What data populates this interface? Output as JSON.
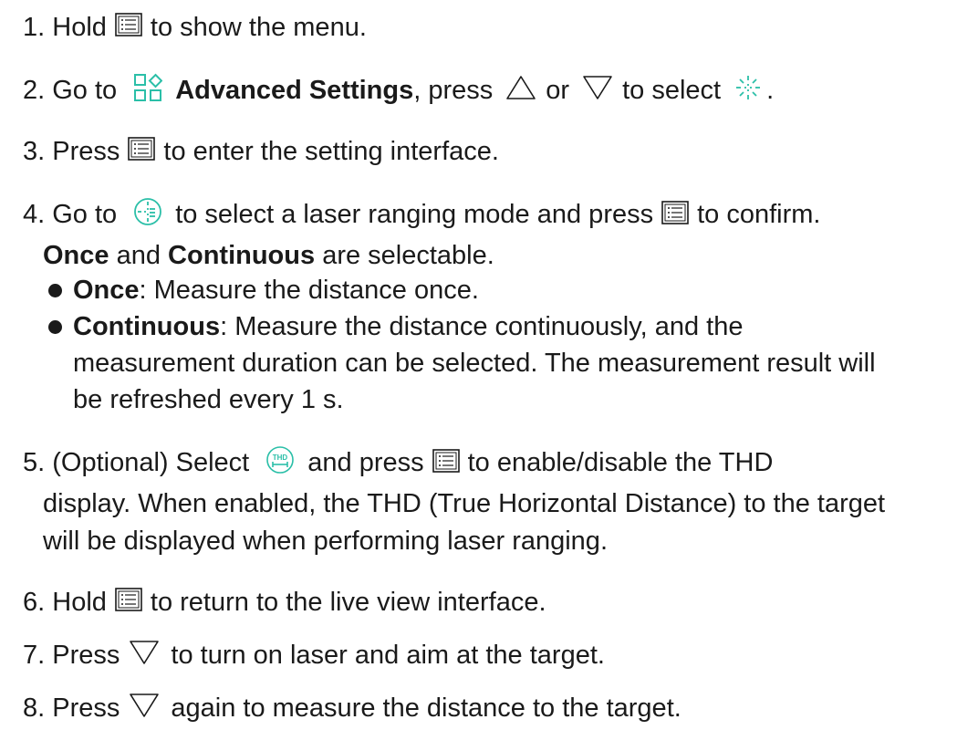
{
  "steps": [
    {
      "num": "1.",
      "a": "Hold",
      "b": "to show the menu."
    },
    {
      "num": "2.",
      "a": "Go to",
      "b_bold": "Advanced Settings",
      "b": ", press",
      "c": "or",
      "d": "to select",
      "e": "."
    },
    {
      "num": "3.",
      "a": "Press",
      "b": "to enter the setting interface."
    },
    {
      "num": "4.",
      "a": "Go to",
      "b": "to select a laser ranging mode and press",
      "c": "to confirm."
    },
    {
      "num": "5.",
      "a": "(Optional) Select",
      "b": "and press",
      "c": "to enable/disable the THD",
      "cont1": "display. When enabled, the THD (True Horizontal Distance) to the target",
      "cont2": "will be displayed when performing laser ranging."
    },
    {
      "num": "6.",
      "a": "Hold",
      "b": "to return to the live view interface."
    },
    {
      "num": "7.",
      "a": "Press",
      "b": "to turn on laser and aim at the target."
    },
    {
      "num": "8.",
      "a": "Press",
      "b": "again to measure the distance to the target."
    }
  ],
  "modes": {
    "intro_once": "Once",
    "intro_and": "and",
    "intro_continuous": "Continuous",
    "intro_rest": "are selectable.",
    "bullets": [
      {
        "term": "Once",
        "desc": ": Measure the distance once."
      },
      {
        "term": "Continuous",
        "desc": ": Measure the distance continuously, and the",
        "cont1": "measurement duration can be selected. The measurement result will",
        "cont2": "be refreshed every 1 s."
      }
    ]
  },
  "icons": {
    "menu": "menu-button-icon",
    "advanced": "advanced-settings-icon",
    "up": "up-triangle-icon",
    "down": "down-triangle-icon",
    "laser": "laser-ranging-icon",
    "laser_mode": "laser-ranging-mode-icon",
    "thd": "thd-icon"
  },
  "colors": {
    "accent": "#2bbfa8",
    "text": "#1a1a1a"
  }
}
